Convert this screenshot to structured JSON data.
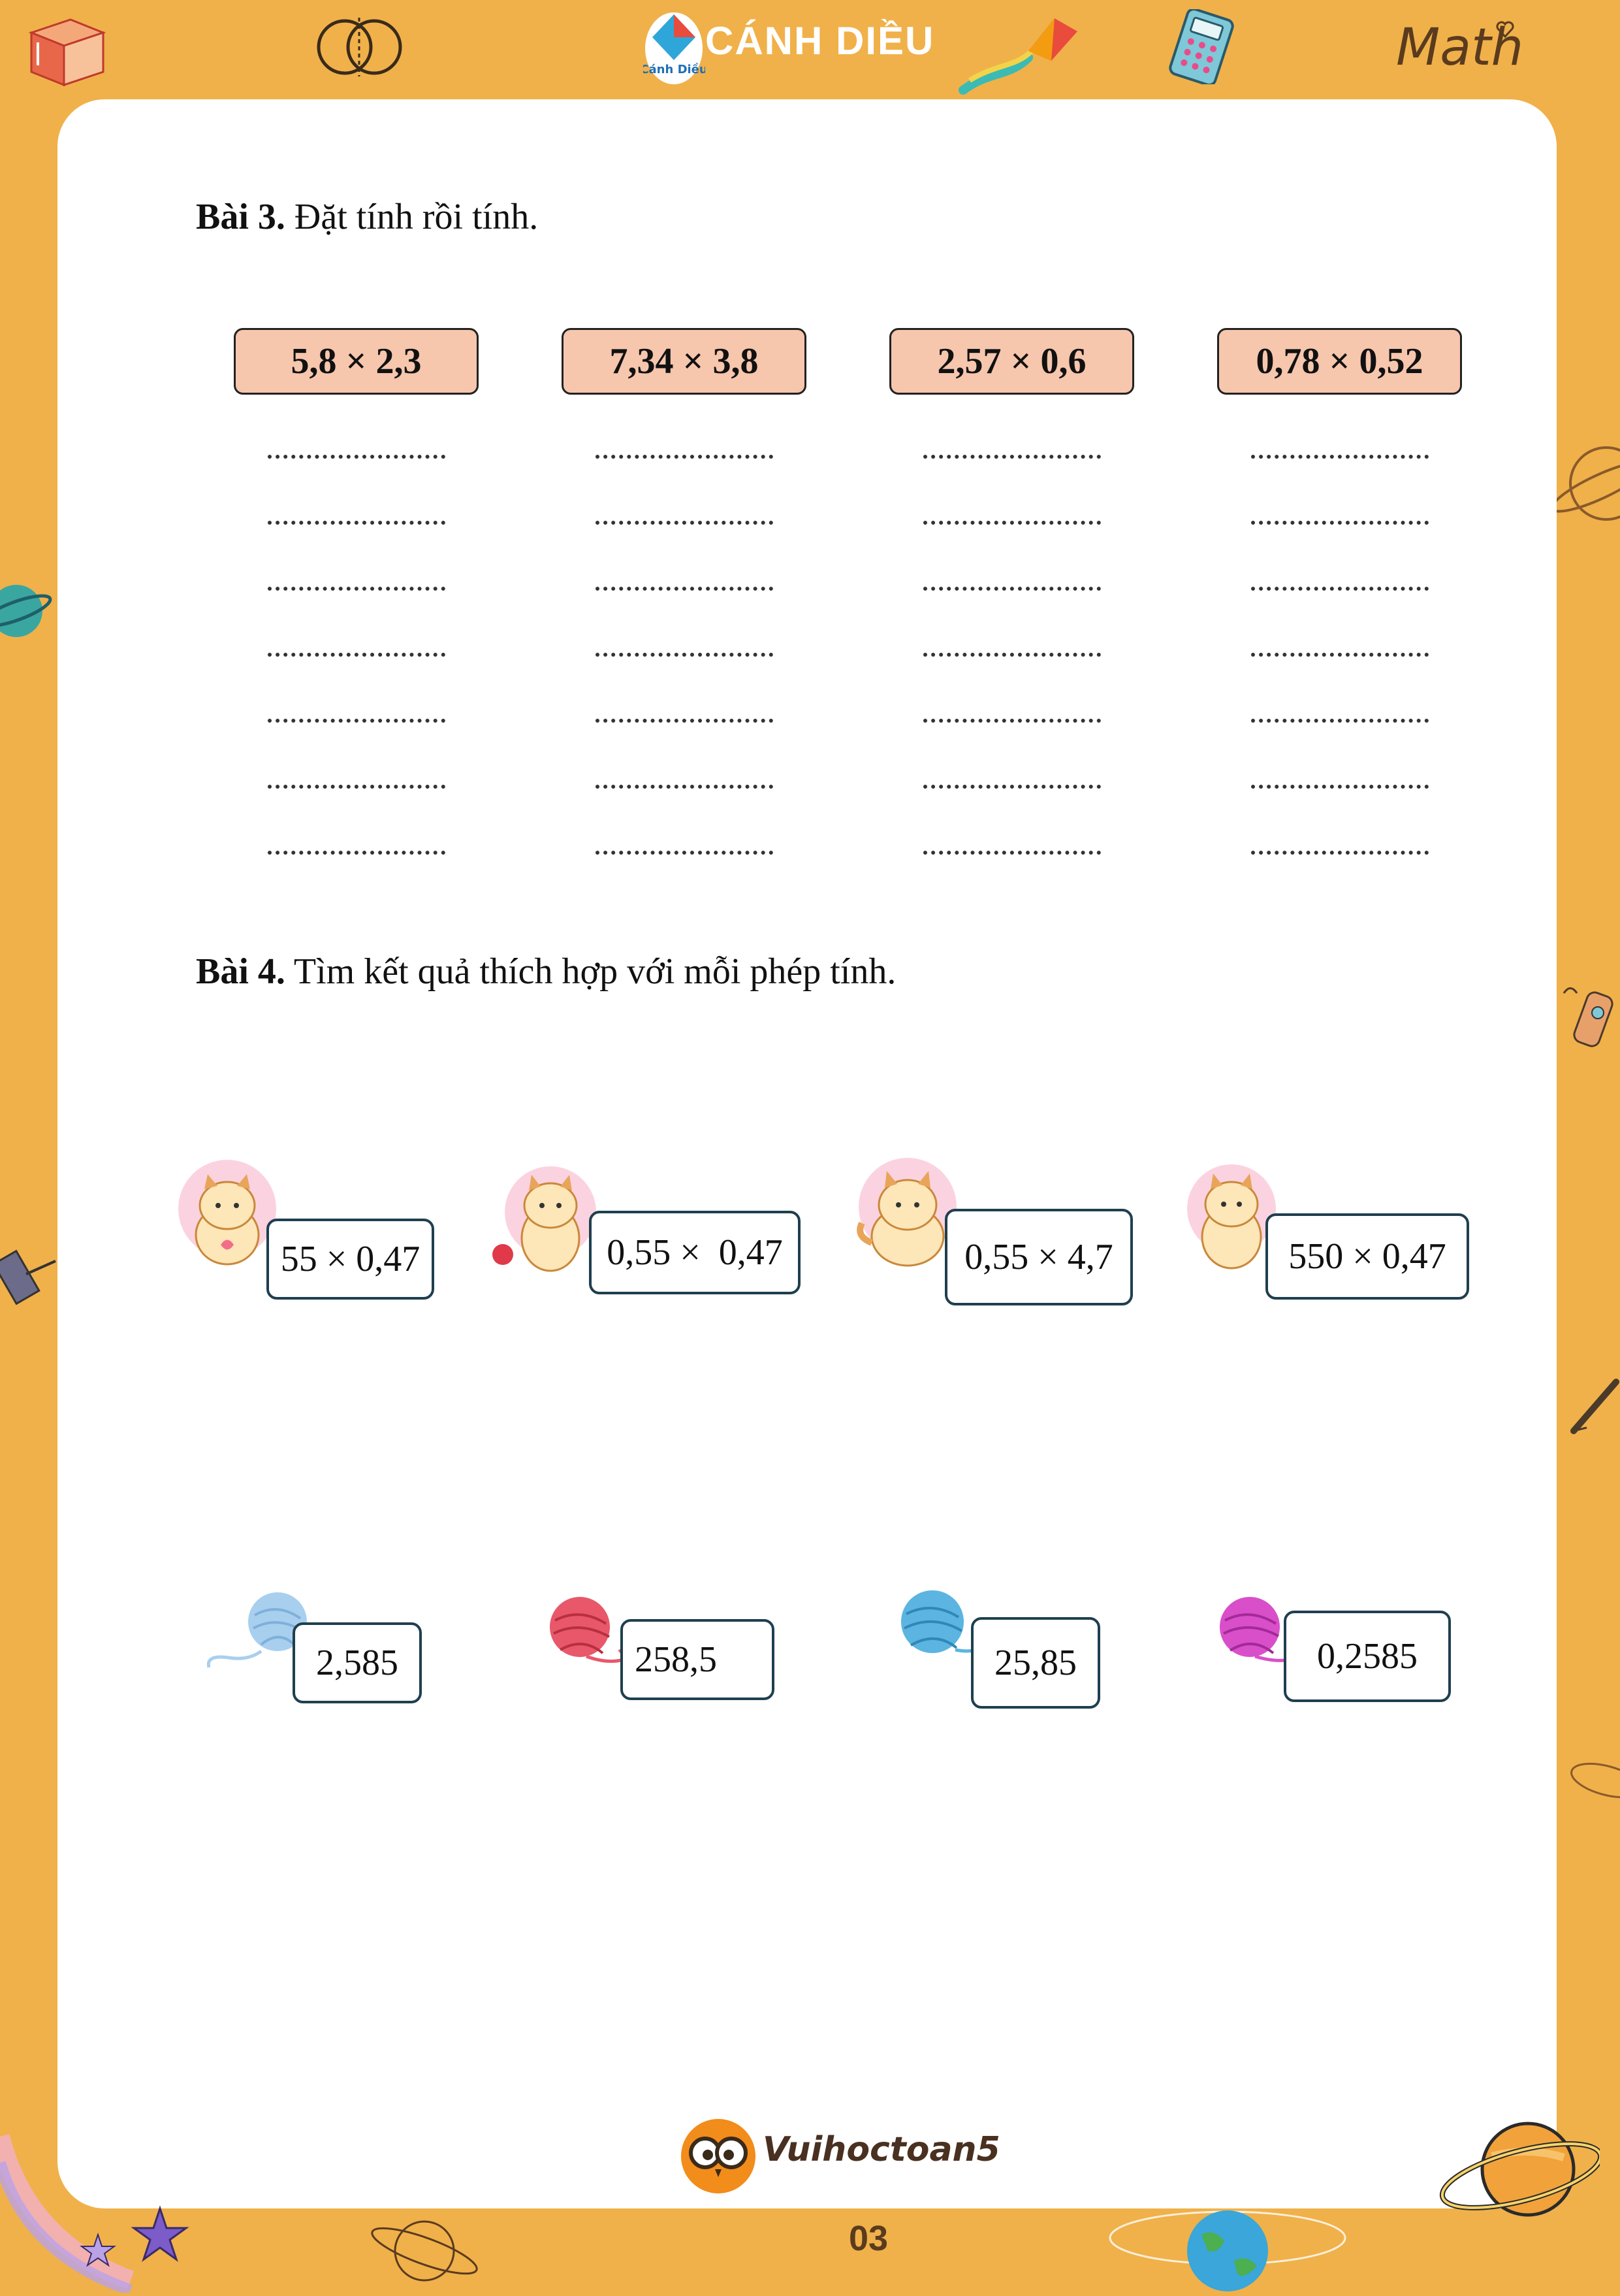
{
  "header": {
    "brand": "CÁNH DIỀU",
    "logo_text": "Cánh Diều",
    "math": "Math",
    "icons": [
      "ruler-cube-icon",
      "venn-diagram-icon",
      "kite-icon",
      "calculator-icon",
      "heart-icon"
    ]
  },
  "exercise3": {
    "label": "Bài 3.",
    "instruction": " Đặt tính rồi tính.",
    "problems": [
      "5,8 × 2,3",
      "7,34 × 3,8",
      "2,57 × 0,6",
      "0,78 × 0,52"
    ],
    "answer_lines_per_problem": 7
  },
  "exercise4": {
    "label": "Bài 4.",
    "instruction": " Tìm kết quả thích hợp với mỗi phép tính.",
    "expressions": [
      "55 × 0,47",
      "0,55 ×  0,47",
      "0,55 × 4,7",
      "550 × 0,47"
    ],
    "results": [
      "2,585",
      "258,5",
      "25,85",
      "0,2585"
    ],
    "yarn_colors": [
      "#a9cfee",
      "#e8586a",
      "#5bb5e0",
      "#d94fc9"
    ]
  },
  "footer": {
    "brand": "Vuihoctoan5",
    "page_number": "03"
  },
  "colors": {
    "frame": "#f0b14a",
    "box_fill": "#f6c6ad",
    "border": "#1f3f4f"
  }
}
